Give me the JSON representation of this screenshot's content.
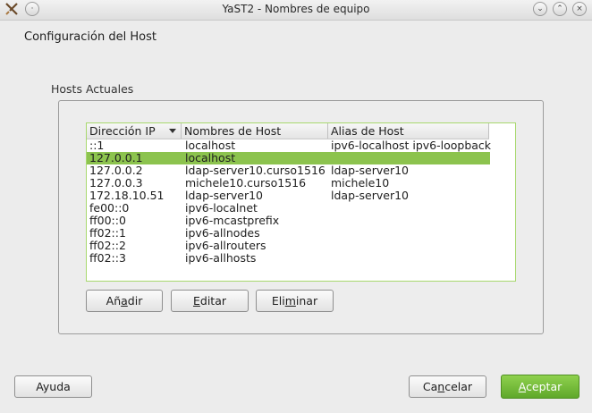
{
  "window": {
    "title": "YaST2 - Nombres de equipo"
  },
  "heading": "Configuración del Host",
  "group_label": "Hosts Actuales",
  "table": {
    "columns": [
      "Dirección IP",
      "Nombres de Host",
      "Alias de Host"
    ],
    "rows": [
      {
        "ip": "::1",
        "host": "localhost",
        "alias": "ipv6-localhost ipv6-loopback"
      },
      {
        "ip": "127.0.0.1",
        "host": "localhost",
        "alias": ""
      },
      {
        "ip": "127.0.0.2",
        "host": "ldap-server10.curso1516",
        "alias": "ldap-server10"
      },
      {
        "ip": "127.0.0.3",
        "host": "michele10.curso1516",
        "alias": "michele10"
      },
      {
        "ip": "172.18.10.51",
        "host": "ldap-server10",
        "alias": "ldap-server10"
      },
      {
        "ip": "fe00::0",
        "host": "ipv6-localnet",
        "alias": ""
      },
      {
        "ip": "ff00::0",
        "host": "ipv6-mcastprefix",
        "alias": ""
      },
      {
        "ip": "ff02::1",
        "host": "ipv6-allnodes",
        "alias": ""
      },
      {
        "ip": "ff02::2",
        "host": "ipv6-allrouters",
        "alias": ""
      },
      {
        "ip": "ff02::3",
        "host": "ipv6-allhosts",
        "alias": ""
      }
    ],
    "selected_row": "127.0.0.1"
  },
  "buttons": {
    "add": {
      "before": "Añ",
      "key": "a",
      "after": "dir"
    },
    "edit": {
      "before": "",
      "key": "E",
      "after": "ditar"
    },
    "delete": {
      "before": "Eli",
      "key": "m",
      "after": "inar"
    },
    "help": "Ayuda",
    "cancel": {
      "before": "Ca",
      "key": "n",
      "after": "celar"
    },
    "accept": {
      "before": "",
      "key": "A",
      "after": "ceptar"
    }
  },
  "colors": {
    "selection": "#8cc34e",
    "accent": "#6ab533"
  }
}
